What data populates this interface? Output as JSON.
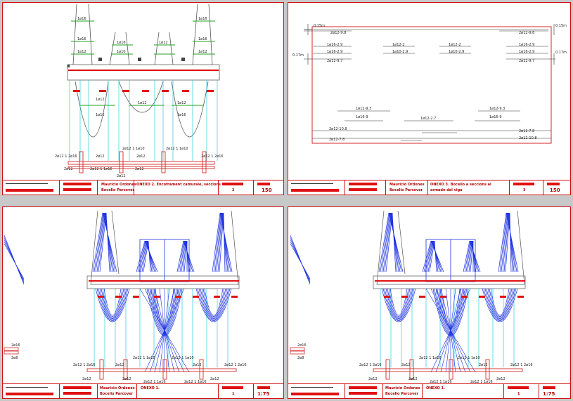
{
  "sheets": {
    "s1": {
      "authors": [
        "Mauricio Ordones",
        "Bocelio Parcover"
      ],
      "title": "ONEXO 2. Encoframent camurale, seccions",
      "num": "2",
      "scale": "150",
      "top_labels": [
        "1ø16",
        "1ø16",
        "1ø12",
        "1ø16",
        "1ø10",
        "1ø12",
        "1ø16",
        "1ø16",
        "1ø12"
      ],
      "mid_labels": [
        "1ø12",
        "1ø12",
        "1ø16",
        "1ø12",
        "1ø16"
      ],
      "bot_labels": [
        "2ø12 1 2ø16",
        "2ø12",
        "2ø12 1 1ø10",
        "2ø12",
        "2ø12 1 1ø10",
        "2ø12 1 2ø16",
        "2ø12",
        "2ø12 1 1ø16",
        "2ø12",
        "2ø12"
      ]
    },
    "s2": {
      "authors": [
        "Mauricio Ordones",
        "Bocelio Parcover"
      ],
      "title": "ONEXO 3. Bocello a seccions al",
      "title2": "armado del viga",
      "num": "3",
      "scale": "150",
      "rows": [
        "2ø12-9.8",
        "2ø12-9.8",
        "1ø16-2.9",
        "1ø12-2",
        "1ø12-2",
        "1ø16-2.9",
        "1ø16-2.9",
        "1ø10-2.9",
        "1ø10-2.9",
        "1ø16-2.9",
        "2ø12-9.7",
        "2ø12-9.7",
        "1ø12-9.3",
        "1ø12-9.3",
        "1ø16-9",
        "1ø12-2.7",
        "1ø16-9",
        "2ø12-10.8",
        "2ø12-7.8",
        "2ø12-7.8",
        "2ø12-10.8"
      ],
      "levels": [
        "0.15m",
        "0.15m",
        "0.17m",
        "0.17m"
      ]
    },
    "s3": {
      "authors": [
        "Mauricio Ordones",
        "Bocelio Parcover"
      ],
      "title": "ONEXO 1.",
      "num": "1",
      "scale": "1:75",
      "labels": [
        "2ø12 1 2ø16",
        "2ø12",
        "2ø12 1 1ø10",
        "2ø12 1 1ø10",
        "2ø12",
        "2ø12 1 2ø16",
        "2ø12",
        "2ø12",
        "2ø12 1 1ø16",
        "2ø12 1 1ø16",
        "2ø12",
        "2ø16",
        "2ø8"
      ]
    },
    "s4": {
      "authors": [
        "Mauricio Ordones",
        "Bocelio Parcover"
      ],
      "title": "ONEXO 1.",
      "num": "1",
      "scale": "1:75",
      "labels": [
        "2ø12 1 2ø16",
        "2ø12",
        "2ø12 1 1ø10",
        "2ø12 1 1ø10",
        "2ø12",
        "2ø12 1 2ø16",
        "2ø12",
        "2ø12",
        "2ø12 1 1ø16",
        "2ø12 1 1ø16",
        "2ø12",
        "2ø16",
        "2ø8"
      ]
    }
  },
  "colors": {
    "frame": "#d01010",
    "line": "#555555",
    "cyan": "#00c8d8",
    "green": "#22a022",
    "blue": "#1a2fe0",
    "bg": "#c8c8c8"
  }
}
